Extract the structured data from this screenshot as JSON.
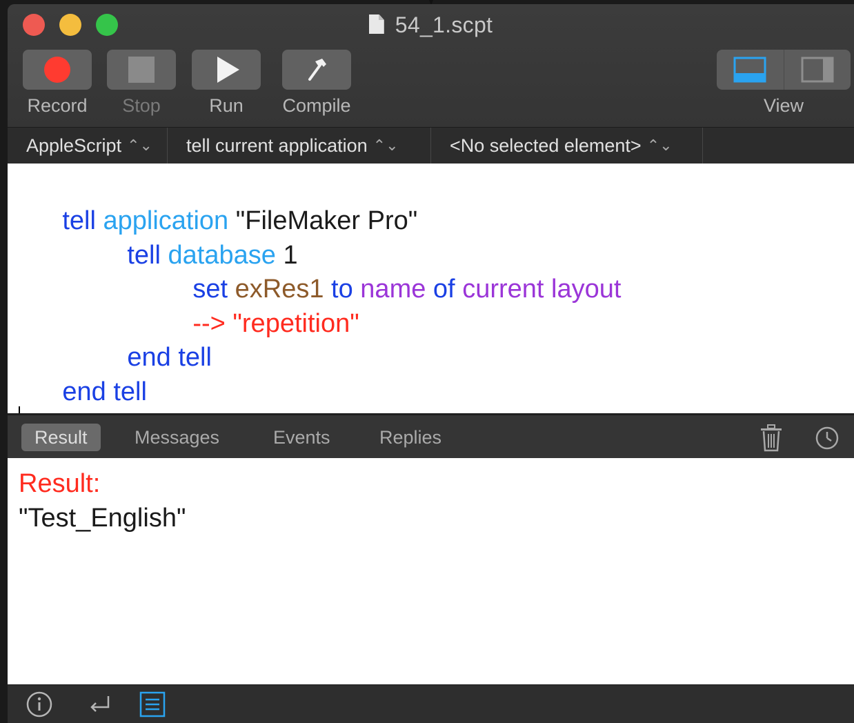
{
  "window": {
    "title": "54_1.scpt"
  },
  "toolbar": {
    "record_label": "Record",
    "stop_label": "Stop",
    "run_label": "Run",
    "compile_label": "Compile",
    "view_label": "View",
    "icons": {
      "record": "record-icon",
      "stop": "stop-icon",
      "run": "play-icon",
      "compile": "hammer-icon",
      "view_bottom": "bottom-panel-icon",
      "view_side": "side-panel-icon"
    }
  },
  "navbar": {
    "language": "AppleScript",
    "target": "tell current application",
    "element": "<No selected element>"
  },
  "script": {
    "lines": [
      {
        "tokens": [
          "tell",
          "application",
          "\"FileMaker Pro\""
        ]
      },
      {
        "tokens": [
          "tell",
          "database",
          "1"
        ]
      },
      {
        "tokens": [
          "set",
          "exRes1",
          "to",
          "name",
          "of",
          "current layout"
        ]
      },
      {
        "tokens": [
          "--> \"repetition\""
        ]
      },
      {
        "tokens": [
          "end tell"
        ]
      },
      {
        "tokens": [
          "end tell"
        ]
      }
    ]
  },
  "result_tabs": {
    "tabs": [
      "Result",
      "Messages",
      "Events",
      "Replies"
    ],
    "active": "Result"
  },
  "result": {
    "label": "Result:",
    "value": "\"Test_English\""
  },
  "bottombar": {
    "icons": [
      "info-icon",
      "return-icon",
      "list-icon"
    ]
  },
  "colors": {
    "keyword": "#1a40e4",
    "application": "#2aa3f0",
    "variable": "#8d5a2a",
    "property": "#9b35d8",
    "comment": "#ff2b1f",
    "accent_blue": "#2aa3f0"
  }
}
